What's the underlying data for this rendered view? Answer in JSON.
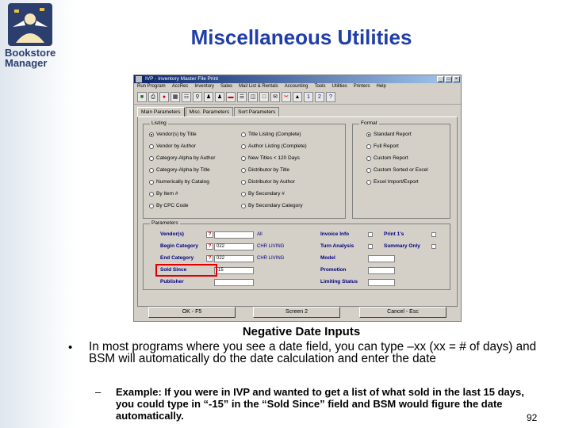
{
  "slide": {
    "title": "Miscellaneous Utilities",
    "logo_text_line1": "Bookstore",
    "logo_text_line2": "Manager",
    "subheading": "Negative Date Inputs",
    "bullet": "In most programs where you see a date field, you can type –xx (xx = # of days) and BSM will automatically do the date calculation and enter the date",
    "sub_bullet": "Example: If you were in IVP and wanted to get a list of what sold in the last 15 days, you could type in “-15” in the “Sold Since” field and BSM would figure the date automatically.",
    "page_number": "92"
  },
  "app": {
    "title": "IVP - Inventory Master File Print",
    "menu": [
      "Run Program",
      "AccRec",
      "Inventory",
      "Sales",
      "Mail List & Rentals",
      "Accounting",
      "Tools",
      "Utilities",
      "Printers",
      "Help"
    ],
    "tabs": [
      "Main Parameters",
      "Misc. Parameters",
      "Sort Parameters"
    ],
    "listing_label": "Listing",
    "format_label": "Format",
    "parameters_label": "Parameters",
    "listing_col1": [
      "Vendor(s) by Title",
      "Vendor by Author",
      "Category-Alpha by Author",
      "Category-Alpha by Title",
      "Numerically by Catalog",
      "By Item #",
      "By CPC Code"
    ],
    "listing_col2": [
      "Title Listing (Complete)",
      "Author Listing (Complete)",
      "New Titles < 120 Days",
      "Distributor by Title",
      "Distributor by Author",
      "By Secondary #",
      "By Secondary Category"
    ],
    "format_options": [
      "Standard Report",
      "Full Report",
      "Custom Report",
      "Custom Sorted or Excel",
      "Excel Import/Export"
    ],
    "params": {
      "vendor_label": "Vendor(s)",
      "vendor_value": "All",
      "begin_label": "Begin Category",
      "begin_input": "022",
      "begin_value": "CHR LIVING",
      "end_label": "End Category",
      "end_input": "022",
      "end_value": "CHR LIVING",
      "sold_since_label": "Sold Since",
      "sold_since_input": "-15",
      "publisher_label": "Publisher",
      "invoice_label": "Invoice Info",
      "print_label": "Print 1's",
      "turn_label": "Turn Analysis",
      "summary_label": "Summary Only",
      "model_label": "Model",
      "promotion_label": "Promotion",
      "limiting_label": "Limiting Status",
      "qmark": "?"
    },
    "buttons": {
      "ok": "OK - F5",
      "screen2": "Screen 2",
      "cancel": "Cancel - Esc"
    },
    "window_controls": [
      "_",
      "□",
      "×"
    ]
  }
}
